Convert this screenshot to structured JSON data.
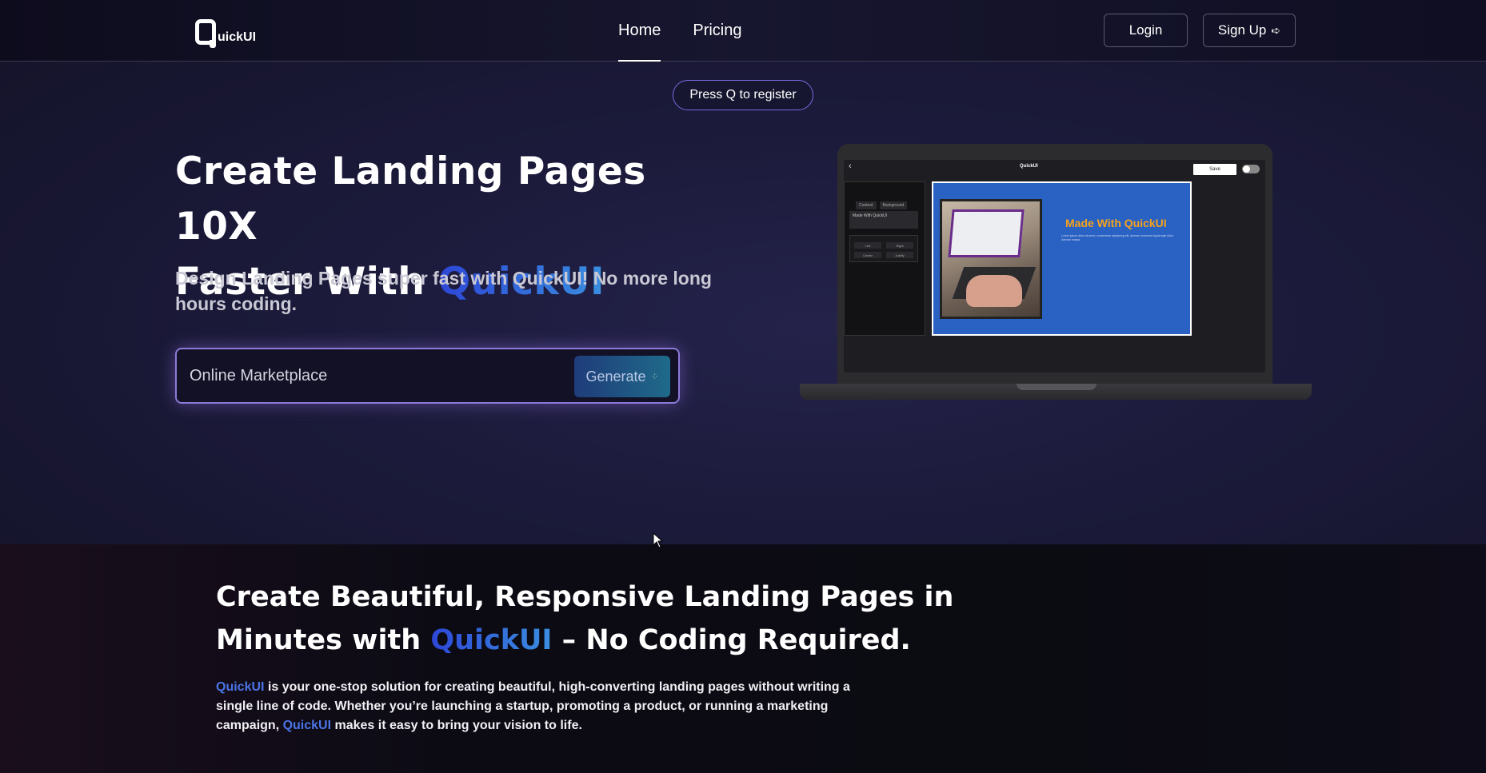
{
  "nav": {
    "logo_letter": "Q",
    "logo_text": "uickUI",
    "links": [
      {
        "label": "Home",
        "active": true
      },
      {
        "label": "Pricing",
        "active": false
      }
    ],
    "login_label": "Login",
    "signup_label": "Sign Up",
    "signup_icon": "arrow-right-icon"
  },
  "hero": {
    "pill_text": "Press Q to register",
    "title_line1": "Create Landing Pages 10X",
    "title_line2_prefix": "Faster With ",
    "title_brand": "QuickUI",
    "subtitle": "Design Landing Pages super fast with QuickUI! No more long hours coding.",
    "input_value": "Online Marketplace",
    "generate_label": "Generate",
    "generate_icon": "sparkle-icon"
  },
  "mockup": {
    "logo": "QuickUI",
    "save_label": "Save",
    "sidebar_tabs": [
      "Content",
      "Background"
    ],
    "sidebar_field": "Made With QuickUI",
    "align_buttons": [
      "Left",
      "Right",
      "Center",
      "Justify"
    ],
    "canvas_heading": "Made With QuickUI",
    "canvas_lorem": "Lorem ipsum dolor sit amet, consectetur adipiscing elit, Aenean commodo ligula eget dolor. Aenean massa."
  },
  "section2": {
    "title_line1": "Create Beautiful, Responsive Landing Pages in",
    "title_line2_prefix": "Minutes with ",
    "title_brand": "QuickUI",
    "title_line2_suffix": " – No Coding Required.",
    "para_brand1": "QuickUI",
    "para_text1": " is your one-stop solution for creating beautiful, high-converting landing pages without writing a single line of code. Whether you’re launching a startup, promoting a product, or running a marketing campaign, ",
    "para_brand2": "QuickUI",
    "para_text2": " makes it easy to bring your vision to life."
  },
  "colors": {
    "brand_gradient_start": "#2d46d6",
    "brand_gradient_end": "#3a8fe0",
    "pill_border": "#7a6ae0",
    "glow": "#8d7ad8",
    "canvas_bg": "#2962c3",
    "canvas_heading": "#f6a21c"
  }
}
